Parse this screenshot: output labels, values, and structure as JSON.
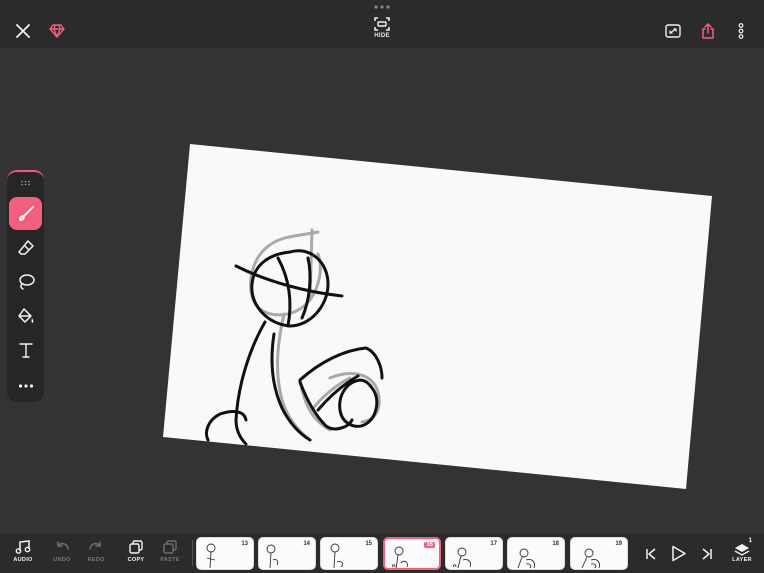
{
  "top_bar": {
    "close_icon": "close-icon",
    "premium_icon": "diamond-icon",
    "hide_label": "HIDE",
    "right_icons": [
      "fullscreen-icon",
      "share-icon",
      "more-vertical-icon"
    ],
    "accent_color": "#f3607f"
  },
  "toolbox": {
    "tools": [
      {
        "name": "brush",
        "icon": "brush-icon",
        "active": true
      },
      {
        "name": "eraser",
        "icon": "eraser-icon",
        "active": false
      },
      {
        "name": "lasso",
        "icon": "lasso-icon",
        "active": false
      },
      {
        "name": "fill",
        "icon": "paint-bucket-icon",
        "active": false
      },
      {
        "name": "text",
        "icon": "text-icon",
        "active": false
      },
      {
        "name": "more",
        "icon": "more-horizontal-icon",
        "active": false
      }
    ]
  },
  "bottom_bar": {
    "audio_label": "AUDIO",
    "undo_label": "UNDO",
    "redo_label": "REDO",
    "copy_label": "COPY",
    "paste_label": "PASTE",
    "frames": [
      {
        "number": "13",
        "current": false
      },
      {
        "number": "14",
        "current": false
      },
      {
        "number": "15",
        "current": false
      },
      {
        "number": "16",
        "current": true
      },
      {
        "number": "17",
        "current": false
      },
      {
        "number": "18",
        "current": false
      },
      {
        "number": "19",
        "current": false
      }
    ],
    "playback_icons": [
      "skip-to-start-icon",
      "play-icon",
      "skip-to-end-icon"
    ],
    "layer_label": "LAYER",
    "layer_count": "1"
  }
}
